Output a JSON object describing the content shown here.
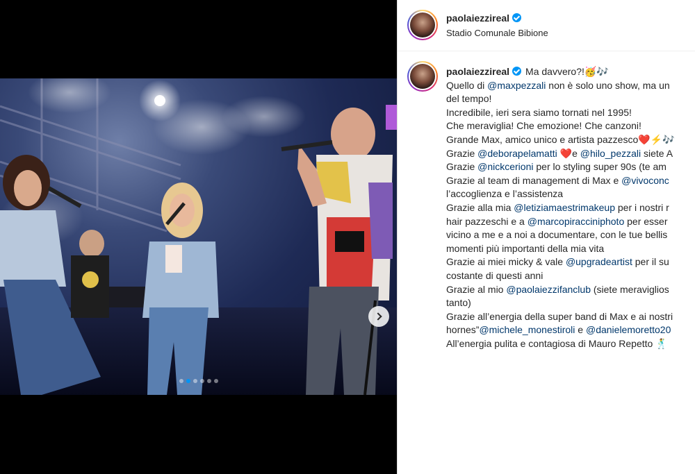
{
  "post": {
    "username": "paolaiezzireal",
    "location": "Stadio Comunale Bibione",
    "carousel": {
      "count": 6,
      "active": 1
    },
    "accent_color": "#0095f6"
  },
  "caption": {
    "username": "paolaiezzireal",
    "lines": [
      [
        {
          "t": "Ma davvero?!🥳🎶"
        }
      ],
      [
        {
          "t": "Quello di "
        },
        {
          "t": "@maxpezzali",
          "m": true
        },
        {
          "t": " non è solo uno show, ma un"
        }
      ],
      [
        {
          "t": "del tempo!"
        }
      ],
      [
        {
          "t": "Incredibile, ieri sera siamo tornati nel 1995!"
        }
      ],
      [
        {
          "t": "Che meraviglia! Che emozione! Che canzoni!"
        }
      ],
      [
        {
          "t": "Grande Max, amico unico e artista pazzesco❤️⚡🎶"
        }
      ],
      [
        {
          "t": "Grazie "
        },
        {
          "t": "@deborapelamatti",
          "m": true
        },
        {
          "t": " ❤️e "
        },
        {
          "t": "@hilo_pezzali",
          "m": true
        },
        {
          "t": " siete A"
        }
      ],
      [
        {
          "t": "Grazie "
        },
        {
          "t": "@nickcerioni",
          "m": true
        },
        {
          "t": " per lo styling super 90s (te am"
        }
      ],
      [
        {
          "t": "Grazie al team di management di Max e "
        },
        {
          "t": "@vivoconc",
          "m": true
        }
      ],
      [
        {
          "t": "l’accoglienza e l’assistenza"
        }
      ],
      [
        {
          "t": "Grazie alla mia "
        },
        {
          "t": "@letiziamaestrimakeup",
          "m": true
        },
        {
          "t": " per i nostri r"
        }
      ],
      [
        {
          "t": "hair pazzeschi e a "
        },
        {
          "t": "@marcopiracciniphoto",
          "m": true
        },
        {
          "t": " per esser"
        }
      ],
      [
        {
          "t": "vicino a me e a noi a documentare, con le tue bellis"
        }
      ],
      [
        {
          "t": "momenti più importanti della mia vita"
        }
      ],
      [
        {
          "t": "Grazie ai miei micky & vale "
        },
        {
          "t": "@upgradeartist",
          "m": true
        },
        {
          "t": " per il su"
        }
      ],
      [
        {
          "t": "costante di questi anni"
        }
      ],
      [
        {
          "t": "Grazie al mio "
        },
        {
          "t": "@paolaiezzifanclub",
          "m": true
        },
        {
          "t": " (siete meraviglios"
        }
      ],
      [
        {
          "t": "tanto)"
        }
      ],
      [
        {
          "t": "Grazie all’energia della super band di Max e ai nostri"
        }
      ],
      [
        {
          "t": "hornes”"
        },
        {
          "t": "@michele_monestiroli",
          "m": true
        },
        {
          "t": " e "
        },
        {
          "t": "@danielemoretto20",
          "m": true
        }
      ],
      [
        {
          "t": "All’energia pulita e contagiosa di Mauro Repetto 🕺"
        }
      ]
    ]
  }
}
